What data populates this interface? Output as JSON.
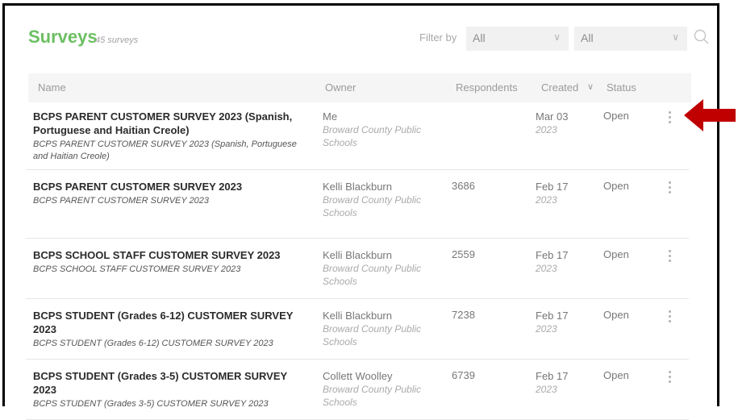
{
  "header": {
    "title": "Surveys",
    "count": "45 surveys",
    "filter_label": "Filter by",
    "filter1": "All",
    "filter2": "All"
  },
  "columns": {
    "name": "Name",
    "owner": "Owner",
    "respondents": "Respondents",
    "created": "Created",
    "status": "Status"
  },
  "rows": [
    {
      "title": "BCPS PARENT CUSTOMER SURVEY 2023 (Spanish, Portuguese and Haitian Creole)",
      "subtitle": "BCPS PARENT CUSTOMER SURVEY 2023 (Spanish, Portuguese and Haitian Creole)",
      "owner": "Me",
      "org": "Broward County Public Schools",
      "respondents": "",
      "date": "Mar 03",
      "year": "2023",
      "status": "Open"
    },
    {
      "title": "BCPS PARENT CUSTOMER SURVEY 2023",
      "subtitle": "BCPS PARENT CUSTOMER SURVEY 2023",
      "owner": "Kelli Blackburn",
      "org": "Broward County Public Schools",
      "respondents": "3686",
      "date": "Feb 17",
      "year": "2023",
      "status": "Open"
    },
    {
      "title": "BCPS SCHOOL STAFF CUSTOMER SURVEY 2023",
      "subtitle": "BCPS SCHOOL STAFF CUSTOMER SURVEY 2023",
      "owner": "Kelli Blackburn",
      "org": "Broward County Public Schools",
      "respondents": "2559",
      "date": "Feb 17",
      "year": "2023",
      "status": "Open"
    },
    {
      "title": "BCPS STUDENT (Grades 6-12) CUSTOMER SURVEY 2023",
      "subtitle": "BCPS STUDENT (Grades 6-12) CUSTOMER SURVEY 2023",
      "owner": "Kelli Blackburn",
      "org": "Broward County Public Schools",
      "respondents": "7238",
      "date": "Feb 17",
      "year": "2023",
      "status": "Open"
    },
    {
      "title": "BCPS STUDENT (Grades 3-5) CUSTOMER SURVEY 2023",
      "subtitle": "BCPS STUDENT (Grades 3-5) CUSTOMER SURVEY 2023",
      "owner": "Collett Woolley",
      "org": "Broward County Public Schools",
      "respondents": "6739",
      "date": "Feb 17",
      "year": "2023",
      "status": "Open"
    }
  ],
  "colors": {
    "accent": "#6cbf62",
    "arrow": "#c00000"
  }
}
